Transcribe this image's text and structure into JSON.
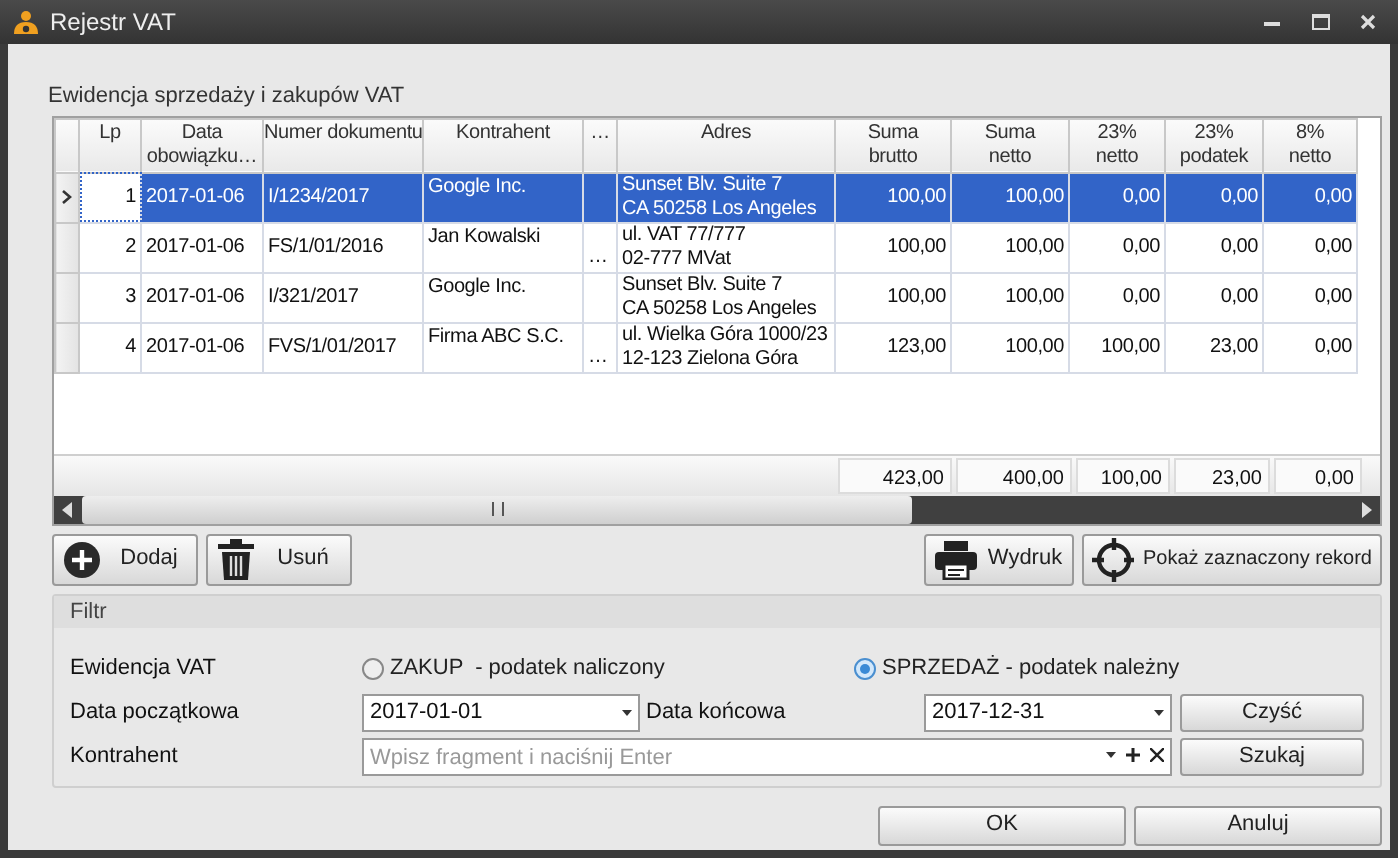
{
  "window": {
    "title": "Rejestr VAT"
  },
  "grid": {
    "caption": "Ewidencja sprzedaży i zakupów VAT",
    "columns": [
      {
        "lines": [
          "Lp"
        ]
      },
      {
        "lines": [
          "Data",
          "obowiązku…"
        ]
      },
      {
        "lines": [
          "Numer dokumentu"
        ]
      },
      {
        "lines": [
          "Kontrahent"
        ]
      },
      {
        "lines": [
          "…"
        ]
      },
      {
        "lines": [
          "Adres"
        ]
      },
      {
        "lines": [
          "Suma",
          "brutto"
        ]
      },
      {
        "lines": [
          "Suma",
          "netto"
        ]
      },
      {
        "lines": [
          "23%",
          "netto"
        ]
      },
      {
        "lines": [
          "23%",
          "podatek"
        ]
      },
      {
        "lines": [
          "8%",
          "netto"
        ]
      }
    ],
    "rows": [
      {
        "selected": true,
        "lp": "1",
        "date": "2017-01-06",
        "number": "I/1234/2017",
        "contractor": "Google Inc.",
        "address": [
          "Sunset Blv. Suite 7",
          "CA 50258 Los Angeles"
        ],
        "amounts": [
          "100,00",
          "100,00",
          "0,00",
          "0,00",
          "0,00"
        ]
      },
      {
        "selected": false,
        "lp": "2",
        "date": "2017-01-06",
        "number": "FS/1/01/2016",
        "contractor": "Jan Kowalski",
        "more": "…",
        "address": [
          "ul. VAT 77/777",
          "02-777 MVat"
        ],
        "amounts": [
          "100,00",
          "100,00",
          "0,00",
          "0,00",
          "0,00"
        ]
      },
      {
        "selected": false,
        "lp": "3",
        "date": "2017-01-06",
        "number": "I/321/2017",
        "contractor": "Google Inc.",
        "address": [
          "Sunset Blv. Suite 7",
          "CA 50258 Los Angeles"
        ],
        "amounts": [
          "100,00",
          "100,00",
          "0,00",
          "0,00",
          "0,00"
        ]
      },
      {
        "selected": false,
        "lp": "4",
        "date": "2017-01-06",
        "number": "FVS/1/01/2017",
        "contractor": "Firma ABC S.C.",
        "more": "…",
        "address": [
          "ul. Wielka Góra 1000/23",
          "12-123 Zielona Góra"
        ],
        "amounts": [
          "123,00",
          "100,00",
          "100,00",
          "23,00",
          "0,00"
        ]
      }
    ],
    "totals": [
      "423,00",
      "400,00",
      "100,00",
      "23,00",
      "0,00"
    ]
  },
  "toolbar": {
    "left": [
      {
        "kind": "add",
        "label": "Dodaj"
      },
      {
        "kind": "delete",
        "label": "Usuń"
      }
    ],
    "right": [
      {
        "kind": "print",
        "label": "Wydruk"
      },
      {
        "kind": "locate",
        "label": "Pokaż zaznaczony rekord"
      }
    ]
  },
  "filter": {
    "legend": "Filtr",
    "register_label": "Ewidencja VAT",
    "options": [
      {
        "label": "ZAKUP  - podatek naliczony",
        "selected": false
      },
      {
        "label": "SPRZEDAŻ - podatek należny",
        "selected": true
      }
    ],
    "start_label": "Data początkowa",
    "start_value": "2017-01-01",
    "end_label": "Data końcowa",
    "end_value": "2017-12-31",
    "clear_button": "Czyść",
    "contractor_label": "Kontrahent",
    "contractor_placeholder": "Wpisz fragment i naciśnij Enter",
    "search_button": "Szukaj"
  },
  "buttons": [
    "OK",
    "Anuluj"
  ]
}
